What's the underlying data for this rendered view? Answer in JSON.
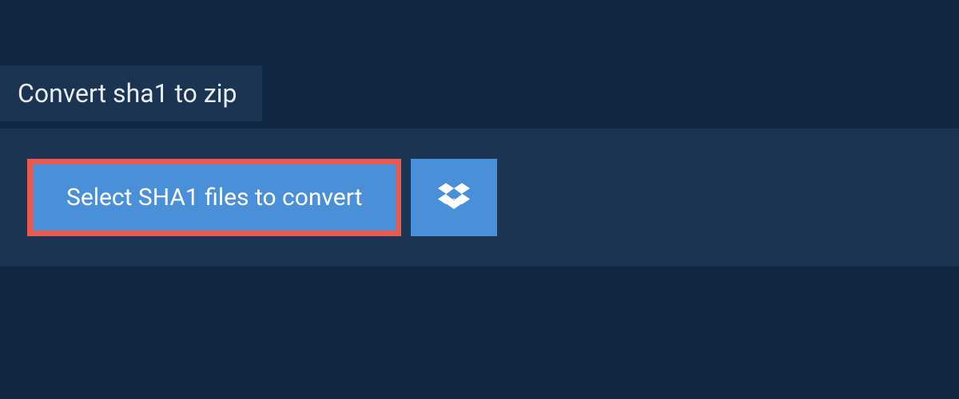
{
  "tab": {
    "title": "Convert sha1 to zip"
  },
  "upload": {
    "select_label": "Select SHA1 files to convert"
  }
}
